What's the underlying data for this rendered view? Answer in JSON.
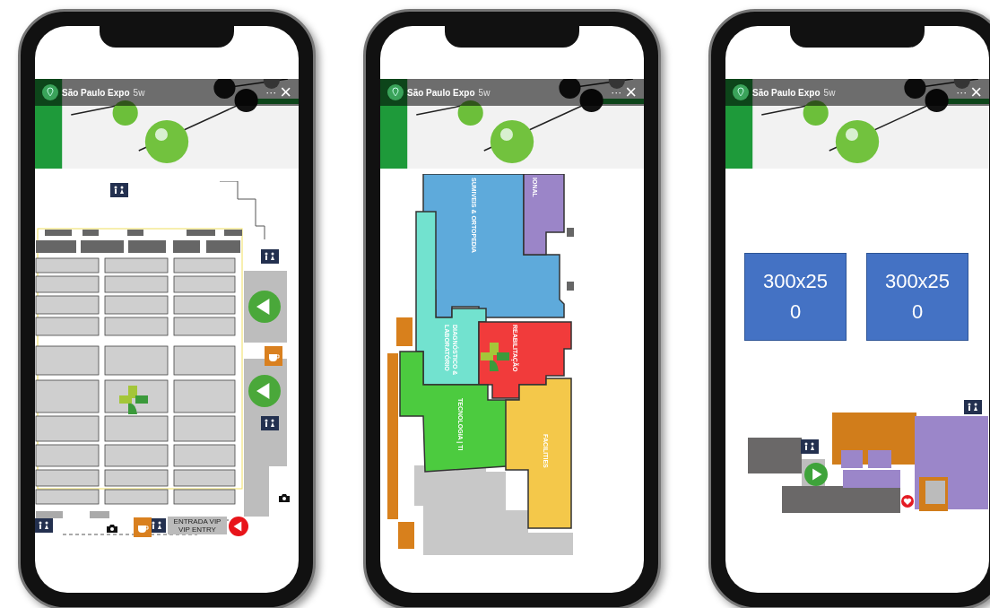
{
  "phones": [
    {
      "kind": "booth-map",
      "header": {
        "account": "São Paulo Expo",
        "age": "5w",
        "more": "···",
        "close": "×"
      },
      "entrance": "ENTRADA VIP VIP ENTRY"
    },
    {
      "kind": "sector-map",
      "header": {
        "account": "São Paulo Expo",
        "age": "5w",
        "more": "···",
        "close": "×"
      },
      "sectors": [
        {
          "name": "SUMIVEIS & ORTOPEDIA",
          "color": "#5eaadb"
        },
        {
          "name": "IONAL",
          "color": "#9b85c8"
        },
        {
          "name": "DIAGNÓSTICO & LABORATÓRIO",
          "color": "#72e2cf"
        },
        {
          "name": "REABILITAÇÃO",
          "color": "#f13b3b"
        },
        {
          "name": "TECNOLOGIA | TI",
          "color": "#4ccb3f"
        },
        {
          "name": "FACILITIES",
          "color": "#f4c84a"
        }
      ]
    },
    {
      "kind": "ad-map",
      "header": {
        "account": "São Paulo Expo",
        "age": "5w",
        "more": "···",
        "close": "×"
      },
      "ads": [
        "300x250",
        "300x250"
      ]
    }
  ]
}
